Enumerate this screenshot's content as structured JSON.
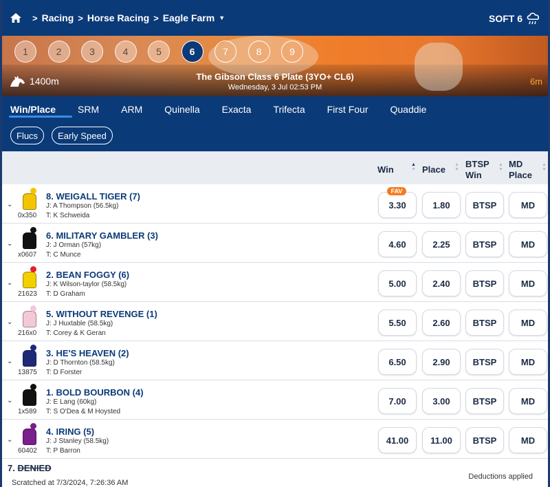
{
  "breadcrumb": {
    "items": [
      "Racing",
      "Horse Racing",
      "Eagle Farm"
    ]
  },
  "track_condition": "SOFT 6",
  "race_numbers": [
    "1",
    "2",
    "3",
    "4",
    "5",
    "6",
    "7",
    "8",
    "9"
  ],
  "selected_race": "6",
  "race": {
    "distance": "1400m",
    "title": "The Gibson Class 6 Plate (3YO+ CL6)",
    "datetime": "Wednesday, 3 Jul 02:53 PM",
    "countdown": "6m"
  },
  "tabs": [
    "Win/Place",
    "SRM",
    "ARM",
    "Quinella",
    "Exacta",
    "Trifecta",
    "First Four",
    "Quaddie"
  ],
  "active_tab": "Win/Place",
  "filters": [
    "Flucs",
    "Early Speed"
  ],
  "columns": {
    "win": "Win",
    "place": "Place",
    "btsp_win": [
      "BTSP",
      "Win"
    ],
    "md_place": [
      "MD",
      "Place"
    ]
  },
  "runners": [
    {
      "name": "8. WEIGALL TIGER (7)",
      "jockey": "J: A Thompson (56.5kg)",
      "trainer": "T: K Schweida",
      "form": "0x350",
      "win": "3.30",
      "place": "1.80",
      "btsp": "BTSP",
      "md": "MD",
      "fav": "FAV",
      "silk": {
        "cap": "#f2c500",
        "body": "#f2c500"
      }
    },
    {
      "name": "6. MILITARY GAMBLER (3)",
      "jockey": "J: J Orman (57kg)",
      "trainer": "T: C Munce",
      "form": "x0607",
      "win": "4.60",
      "place": "2.25",
      "btsp": "BTSP",
      "md": "MD",
      "silk": {
        "cap": "#111111",
        "body": "#111111"
      }
    },
    {
      "name": "2. BEAN FOGGY (6)",
      "jockey": "J: K Wilson-taylor (58.5kg)",
      "trainer": "T: D Graham",
      "form": "21623",
      "win": "5.00",
      "place": "2.40",
      "btsp": "BTSP",
      "md": "MD",
      "silk": {
        "cap": "#e5202a",
        "body": "#f2d000"
      }
    },
    {
      "name": "5. WITHOUT REVENGE (1)",
      "jockey": "J: J Huxtable (58.5kg)",
      "trainer": "T: Corey & K Geran",
      "form": "216x0",
      "win": "5.50",
      "place": "2.60",
      "btsp": "BTSP",
      "md": "MD",
      "silk": {
        "cap": "#f4c9d6",
        "body": "#f4c9d6"
      }
    },
    {
      "name": "3. HE'S HEAVEN (2)",
      "jockey": "J: D Thornton (58.5kg)",
      "trainer": "T: D Forster",
      "form": "13875",
      "win": "6.50",
      "place": "2.90",
      "btsp": "BTSP",
      "md": "MD",
      "silk": {
        "cap": "#1e2a78",
        "body": "#1e2a78"
      }
    },
    {
      "name": "1. BOLD BOURBON (4)",
      "jockey": "J: E Lang (60kg)",
      "trainer": "T: S O'Dea & M Hoysted",
      "form": "1x589",
      "win": "7.00",
      "place": "3.00",
      "btsp": "BTSP",
      "md": "MD",
      "silk": {
        "cap": "#111111",
        "body": "#111111"
      }
    },
    {
      "name": "4. IRING (5)",
      "jockey": "J: J Stanley (58.5kg)",
      "trainer": "T: P Barron",
      "form": "60402",
      "win": "41.00",
      "place": "11.00",
      "btsp": "BTSP",
      "md": "MD",
      "silk": {
        "cap": "#7a1f8c",
        "body": "#7a1f8c"
      }
    }
  ],
  "scratched": {
    "number": "7.",
    "name": "DENIED",
    "time": "Scratched at 7/3/2024, 7:26:36 AM",
    "deductions": "Deductions applied"
  },
  "colors": {
    "brand": "#0b3a78",
    "accent": "#3a8ee8",
    "fav": "#f47b20"
  }
}
